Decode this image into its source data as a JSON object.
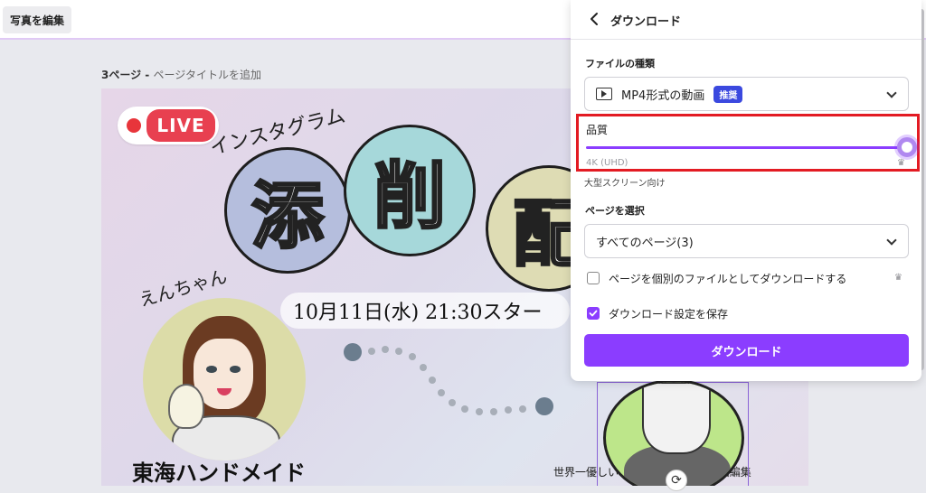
{
  "toolbar": {
    "edit_photo_label": "写真を編集"
  },
  "canvas": {
    "page_number": "3ページ - ",
    "add_title_link": "ページタイトルを追加",
    "design": {
      "live_label": "LIVE",
      "insta_text": "インスタグラム",
      "kanji": [
        "添",
        "削",
        "配"
      ],
      "name_text": "えんちゃん",
      "date_text": "10月11日(水) 21:30スター",
      "brand_text": "東海ハンドメイド",
      "caption_text": "世界一優しい🔰インスタ攻略・動画編集"
    }
  },
  "download_panel": {
    "title": "ダウンロード",
    "file_type": {
      "label": "ファイルの種類",
      "selected": "MP4形式の動画",
      "badge": "推奨"
    },
    "quality": {
      "label": "品質",
      "value": "4K (UHD)",
      "level_fraction": 1.0,
      "description": "大型スクリーン向け"
    },
    "page_select": {
      "label": "ページを選択",
      "selected": "すべてのページ(3)"
    },
    "options": [
      {
        "label": "ページを個別のファイルとしてダウンロードする",
        "checked": false,
        "premium": true
      },
      {
        "label": "ダウンロード設定を保存",
        "checked": true,
        "premium": false
      }
    ],
    "download_button_label": "ダウンロード"
  },
  "colors": {
    "accent": "#8b3dff",
    "badge": "#3b49df",
    "highlight": "#e31b23"
  }
}
